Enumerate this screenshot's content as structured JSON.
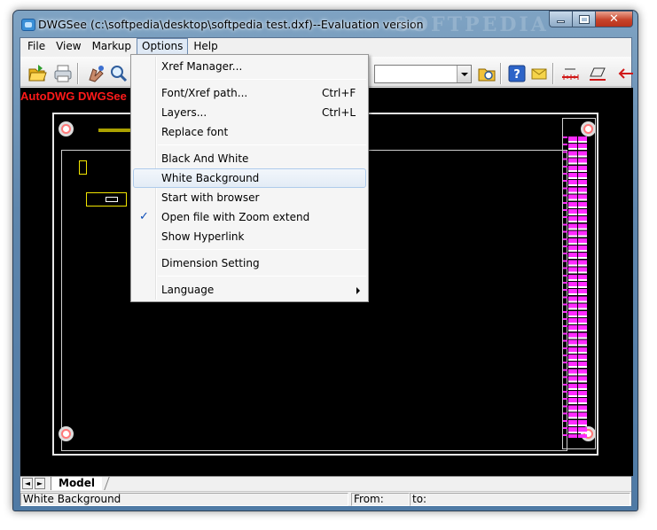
{
  "window": {
    "title": "DWGSee (c:\\softpedia\\desktop\\softpedia test.dxf)--Evaluation version",
    "watermark": "SOFTPEDIA"
  },
  "menubar": {
    "items": [
      "File",
      "View",
      "Markup",
      "Options",
      "Help"
    ],
    "active": "Options"
  },
  "toolbar": {
    "icons": [
      "open-folder-icon",
      "print-icon",
      "markup-hand-icon",
      "zoom-icon",
      "folder-browse-icon",
      "help-icon",
      "email-icon",
      "measure-icon",
      "dimension-icon",
      "arrow-icon"
    ]
  },
  "canvas": {
    "brand_text": "AutoDWG DWGSee",
    "background": "#000000"
  },
  "options_menu": {
    "items": [
      {
        "label": "Xref Manager...",
        "shortcut": ""
      },
      {
        "label": "Font/Xref path...",
        "shortcut": "Ctrl+F"
      },
      {
        "label": "Layers...",
        "shortcut": "Ctrl+L"
      },
      {
        "label": "Replace font",
        "shortcut": ""
      },
      {
        "label": "Black And White",
        "shortcut": ""
      },
      {
        "label": "White Background",
        "shortcut": "",
        "highlighted": true
      },
      {
        "label": "Start with browser",
        "shortcut": ""
      },
      {
        "label": "Open file with Zoom extend",
        "shortcut": "",
        "checked": true
      },
      {
        "label": "Show Hyperlink",
        "shortcut": ""
      },
      {
        "label": "Dimension Setting",
        "shortcut": ""
      },
      {
        "label": "Language",
        "shortcut": "",
        "submenu": true
      }
    ]
  },
  "tabs": {
    "nav_prev": "◄",
    "nav_next": "►",
    "model": "Model"
  },
  "statusbar": {
    "message": "White Background",
    "from_label": "From:",
    "to_label": "to:"
  },
  "colors": {
    "brand_red": "#ff1a1a",
    "pin_magenta": "#ff2bff",
    "label_yellow": "#f2e500",
    "check_blue": "#0c4db8"
  }
}
